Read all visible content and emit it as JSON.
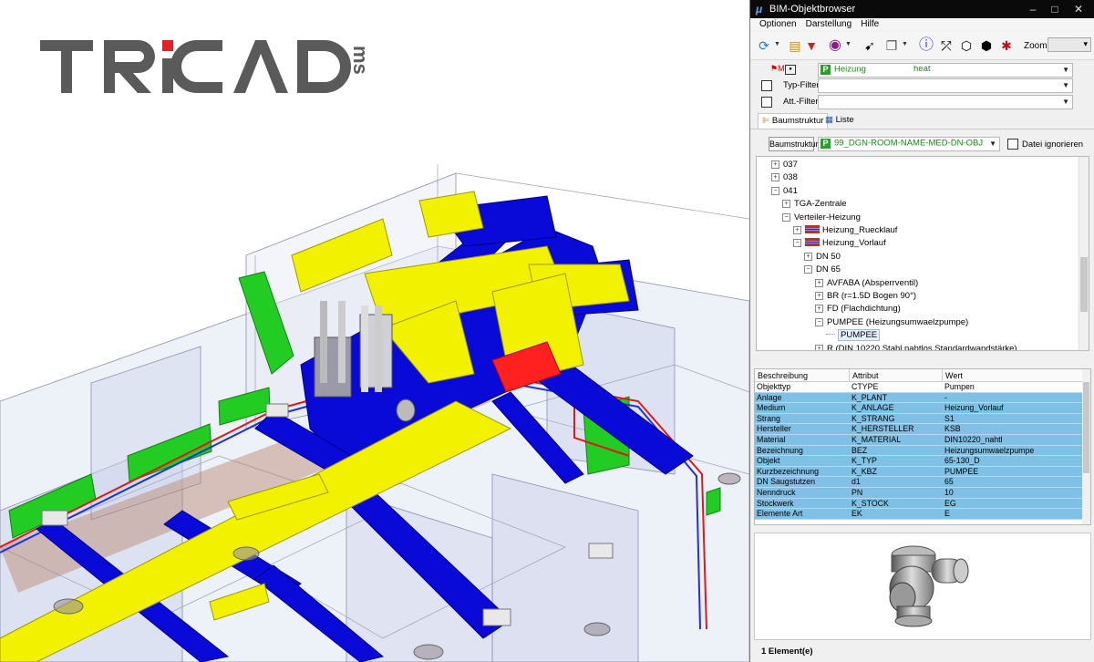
{
  "logo": {
    "text": "TRiCAD",
    "suffix": "ms"
  },
  "window": {
    "title": "BIM-Objektbrowser"
  },
  "menu": [
    "Optionen",
    "Darstellung",
    "Hilfe"
  ],
  "toolbar": {
    "zoom_label": "Zoom",
    "zoom_value": ""
  },
  "filters": {
    "medium_value": "Heizung",
    "medium_code": "heat",
    "typ_label": "Typ-Filter",
    "att_label": "Att.-Filter"
  },
  "tabs": [
    "Baumstruktur",
    "Liste"
  ],
  "baum": {
    "button_label": "Baumstruktur",
    "selected": "99_DGN-ROOM-NAME-MED-DN-OBJ",
    "ignore_label": "Datei ignorieren"
  },
  "tree": [
    {
      "label": "037",
      "level": 1,
      "exp": "+"
    },
    {
      "label": "038",
      "level": 1,
      "exp": "+"
    },
    {
      "label": "041",
      "level": 1,
      "exp": "-"
    },
    {
      "label": "TGA-Zentrale",
      "level": 2,
      "exp": "+"
    },
    {
      "label": "Verteiler-Heizung",
      "level": 2,
      "exp": "-"
    },
    {
      "label": "Heizung_Ruecklauf",
      "level": 3,
      "exp": "+",
      "flag": true
    },
    {
      "label": "Heizung_Vorlauf",
      "level": 3,
      "exp": "-",
      "flag": true
    },
    {
      "label": "DN 50",
      "level": 4,
      "exp": "+"
    },
    {
      "label": "DN 65",
      "level": 4,
      "exp": "-"
    },
    {
      "label": "AVFABA (Absperrventil)",
      "level": 5,
      "exp": "+"
    },
    {
      "label": "BR (r=1.5D Bogen 90°)",
      "level": 5,
      "exp": "+"
    },
    {
      "label": "FD (Flachdichtung)",
      "level": 5,
      "exp": "+"
    },
    {
      "label": "PUMPEE (Heizungsumwaelzpumpe)",
      "level": 5,
      "exp": "-"
    },
    {
      "label": "PUMPEE",
      "level": 6,
      "exp": "",
      "selected": true
    },
    {
      "label": "R (DIN 10220 Stahl nahtlos Standardwandstärke)",
      "level": 5,
      "exp": "+"
    }
  ],
  "properties": {
    "headers": [
      "Beschreibung",
      "Attribut",
      "Wert"
    ],
    "rows": [
      [
        "Objekttyp",
        "CTYPE",
        "Pumpen"
      ],
      [
        "Anlage",
        "K_PLANT",
        "-"
      ],
      [
        "Medium",
        "K_ANLAGE",
        "Heizung_Vorlauf"
      ],
      [
        "Strang",
        "K_STRANG",
        "S1"
      ],
      [
        "Hersteller",
        "K_HERSTELLER",
        "KSB"
      ],
      [
        "Material",
        "K_MATERIAL",
        "DIN10220_nahtl"
      ],
      [
        "Bezeichnung",
        "BEZ",
        "Heizungsumwaelzpumpe"
      ],
      [
        "Objekt",
        "K_TYP",
        "65-130_D"
      ],
      [
        "Kurzbezeichnung",
        "K_KBZ",
        "PUMPEE"
      ],
      [
        "DN Saugstutzen",
        "d1",
        "65"
      ],
      [
        "Nenndruck",
        "PN",
        "10"
      ],
      [
        "Stockwerk",
        "K_STOCK",
        "EG"
      ],
      [
        "Elemente Art",
        "EK",
        "E"
      ]
    ]
  },
  "status": "1 Element(e)",
  "colors": {
    "duct_supply": "#f0f000",
    "duct_exhaust": "#0000dd",
    "green_duct": "#22cc22",
    "row_bg": "#7fc1e6",
    "row_first": "#ffffff"
  }
}
